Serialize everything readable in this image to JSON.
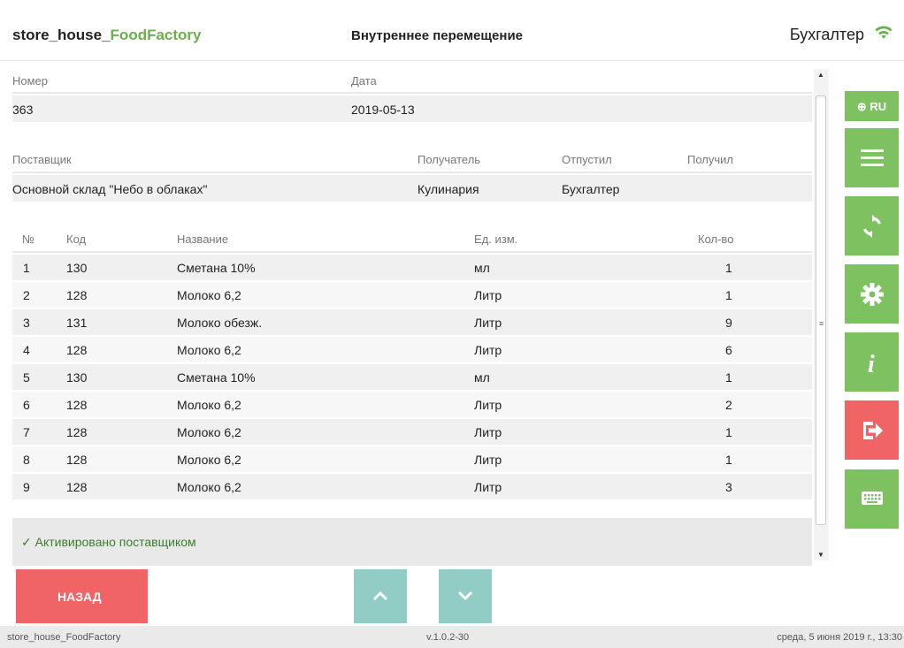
{
  "header": {
    "brand_prefix": "store_house_",
    "brand_accent": "FoodFactory",
    "doc_title": "Внутреннее перемещение",
    "user": "Бухгалтер",
    "wifi_icon": "wifi-icon"
  },
  "doc": {
    "number_label": "Номер",
    "date_label": "Дата",
    "number": "363",
    "date": "2019-05-13",
    "supplier_label": "Поставщик",
    "receiver_label": "Получатель",
    "released_label": "Отпустил",
    "received_label": "Получил",
    "supplier": "Основной склад \"Небо в облаках\"",
    "receiver": "Кулинария",
    "released": "Бухгалтер",
    "received": ""
  },
  "items_table": {
    "columns": [
      "№",
      "Код",
      "Название",
      "Ед. изм.",
      "Кол-во"
    ],
    "rows": [
      [
        "1",
        "130",
        "Сметана 10%",
        "мл",
        "1"
      ],
      [
        "2",
        "128",
        "Молоко 6,2",
        "Литр",
        "1"
      ],
      [
        "3",
        "131",
        "Молоко обезж.",
        "Литр",
        "9"
      ],
      [
        "4",
        "128",
        "Молоко 6,2",
        "Литр",
        "6"
      ],
      [
        "5",
        "130",
        "Сметана 10%",
        "мл",
        "1"
      ],
      [
        "6",
        "128",
        "Молоко 6,2",
        "Литр",
        "2"
      ],
      [
        "7",
        "128",
        "Молоко 6,2",
        "Литр",
        "1"
      ],
      [
        "8",
        "128",
        "Молоко 6,2",
        "Литр",
        "1"
      ],
      [
        "9",
        "128",
        "Молоко 6,2",
        "Литр",
        "3"
      ]
    ]
  },
  "status": "✓ Активировано поставщиком",
  "sidebar": {
    "lang": "RU",
    "buttons": [
      "menu-icon",
      "sync-icon",
      "gear-icon",
      "info-icon",
      "logout-icon",
      "keyboard-icon"
    ]
  },
  "footer_buttons": {
    "back": "НАЗАД"
  },
  "footer": {
    "app": "store_house_FoodFactory",
    "version": "v.1.0.2-30",
    "datetime": "среда, 5 июня 2019 г., 13:30"
  },
  "colors": {
    "green": "#7dc160",
    "red": "#f06466",
    "teal": "#91cdc4",
    "brand_accent": "#6ab04c"
  }
}
